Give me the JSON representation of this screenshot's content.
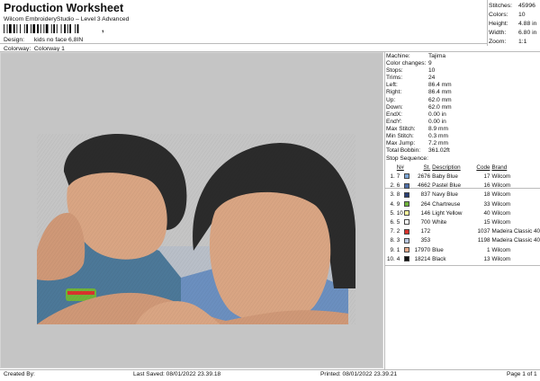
{
  "header": {
    "title": "Production Worksheet",
    "subtitle": "Wilcom EmbroideryStudio – Level 3 Advanced",
    "barcode_tail": ",",
    "design_label": "Design:",
    "design_value": "kids no face 6,8IN",
    "colorway_label": "Colorway:",
    "colorway_value": "Colorway 1"
  },
  "summary": [
    {
      "label": "Stitches:",
      "value": "45996"
    },
    {
      "label": "Colors:",
      "value": "10"
    },
    {
      "label": "Height:",
      "value": "4.88 in"
    },
    {
      "label": "Width:",
      "value": "6.80 in"
    },
    {
      "label": "Zoom:",
      "value": "1:1"
    }
  ],
  "params": [
    {
      "label": "Machine:",
      "value": "Tajima"
    },
    {
      "label": "Color changes:",
      "value": "9"
    },
    {
      "label": "Stops:",
      "value": "10"
    },
    {
      "label": "Trims:",
      "value": "24"
    },
    {
      "label": "Left:",
      "value": "86.4 mm"
    },
    {
      "label": "Right:",
      "value": "86.4 mm"
    },
    {
      "label": "Up:",
      "value": "62.0 mm"
    },
    {
      "label": "Down:",
      "value": "62.0 mm"
    },
    {
      "label": "EndX:",
      "value": "0.00 in"
    },
    {
      "label": "EndY:",
      "value": "0.00 in"
    },
    {
      "label": "Max Stitch:",
      "value": "8.9 mm"
    },
    {
      "label": "Min Stitch:",
      "value": "0.3 mm"
    },
    {
      "label": "Max Jump:",
      "value": "7.2 mm"
    },
    {
      "label": "Total Bobbin:",
      "value": "361.02ft"
    }
  ],
  "sequence": {
    "title": "Stop Sequence:",
    "headers": {
      "n": "N#",
      "st": "St.",
      "desc": "Description",
      "code": "Code",
      "brand": "Brand"
    },
    "rows": [
      {
        "idx": "1.",
        "n": "7",
        "color": "#7ea7d6",
        "st": "2676",
        "desc": "Baby Blue",
        "code": "17",
        "brand": "Wilcom"
      },
      {
        "idx": "2.",
        "n": "6",
        "color": "#4f6fa8",
        "st": "4662",
        "desc": "Pastel Blue",
        "code": "16",
        "brand": "Wilcom"
      },
      {
        "idx": "3.",
        "n": "8",
        "color": "#2a3e74",
        "st": "837",
        "desc": "Navy Blue",
        "code": "18",
        "brand": "Wilcom"
      },
      {
        "idx": "4.",
        "n": "9",
        "color": "#6fb33a",
        "st": "264",
        "desc": "Chartreuse",
        "code": "33",
        "brand": "Wilcom"
      },
      {
        "idx": "5.",
        "n": "10",
        "color": "#fbf59a",
        "st": "146",
        "desc": "Light Yellow",
        "code": "40",
        "brand": "Wilcom"
      },
      {
        "idx": "6.",
        "n": "5",
        "color": "#ffffff",
        "st": "700",
        "desc": "White",
        "code": "15",
        "brand": "Wilcom"
      },
      {
        "idx": "7.",
        "n": "2",
        "color": "#d9332d",
        "st": "172",
        "desc": "",
        "code": "1037",
        "brand": "Madeira Classic 40"
      },
      {
        "idx": "8.",
        "n": "3",
        "color": "#b7c6df",
        "st": "353",
        "desc": "",
        "code": "1198",
        "brand": "Madeira Classic 40"
      },
      {
        "idx": "9.",
        "n": "1",
        "color": "#e6a98a",
        "st": "17970",
        "desc": "Blue",
        "code": "1",
        "brand": "Wilcom"
      },
      {
        "idx": "10.",
        "n": "4",
        "color": "#111111",
        "st": "18214",
        "desc": "Black",
        "code": "13",
        "brand": "Wilcom"
      }
    ]
  },
  "footer": {
    "created_by": "Created By:",
    "last_saved": "Last Saved: 08/01/2022 23.39.18",
    "printed": "Printed: 08/01/2022 23.39.21",
    "page": "Page 1 of 1"
  },
  "colors": {
    "canvas_bg": "#c5c5c5",
    "skin": "#d9a583",
    "skin_shade": "#c98f6e",
    "hair": "#2b2b2b",
    "shirt_left": "#4c7898",
    "shirt_right": "#6b8fbf"
  }
}
